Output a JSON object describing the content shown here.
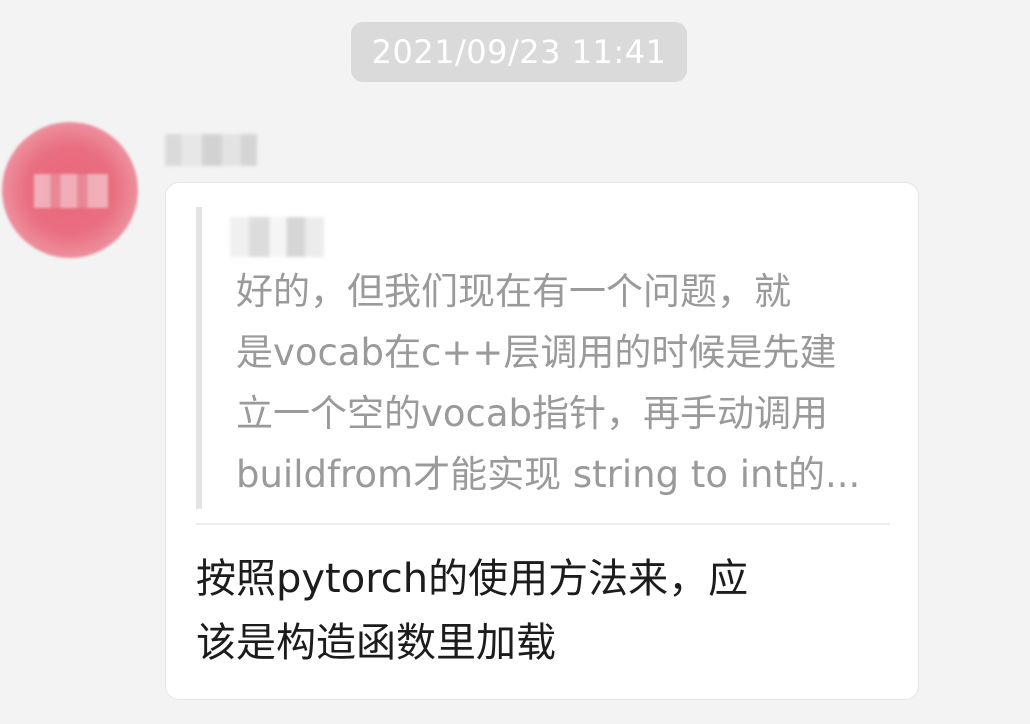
{
  "timestamp": "2021/09/23 11:41",
  "message": {
    "quoted_text": "好的，但我们现在有一个问题，就\n是vocab在c++层调用的时候是先建\n立一个空的vocab指针，再手动调用\nbuildfrom才能实现 string to int的...",
    "reply_text": "按照pytorch的使用方法来，应\n该是构造函数里加载"
  },
  "colors": {
    "background": "#f3f3f3",
    "timestamp_bg": "#dadada",
    "bubble_bg": "#ffffff",
    "quote_text": "#9a9a9a",
    "reply_text": "#1c1c1c",
    "avatar_accent": "#e96e80"
  }
}
